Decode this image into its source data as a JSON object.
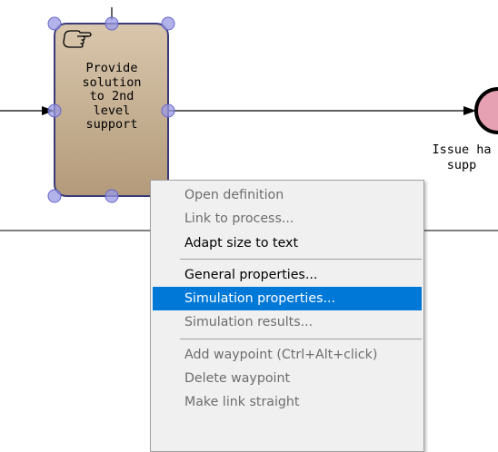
{
  "diagram": {
    "task": {
      "label": "Provide\nsolution\nto 2nd\nlevel\nsupport",
      "icon": "manual-task-hand-icon",
      "fill": "#c8b196",
      "border": "#3a3a78",
      "selected": true
    },
    "end_event": {
      "label": "Issue ha\nsupp",
      "fill": "#e8a0b0"
    },
    "handle_color": "#7a7ad0"
  },
  "context_menu": {
    "groups": [
      [
        {
          "label": "Open definition",
          "enabled": false
        },
        {
          "label": "Link to process...",
          "enabled": false
        },
        {
          "label": "Adapt size to text",
          "enabled": true
        }
      ],
      [
        {
          "label": "General properties...",
          "enabled": true
        },
        {
          "label": "Simulation properties...",
          "enabled": true,
          "highlighted": true
        },
        {
          "label": "Simulation results...",
          "enabled": false
        }
      ],
      [
        {
          "label": "Add waypoint (Ctrl+Alt+click)",
          "enabled": false
        },
        {
          "label": "Delete waypoint",
          "enabled": false
        },
        {
          "label": "Make link straight",
          "enabled": false
        }
      ]
    ],
    "highlight_color": "#0078d7"
  }
}
